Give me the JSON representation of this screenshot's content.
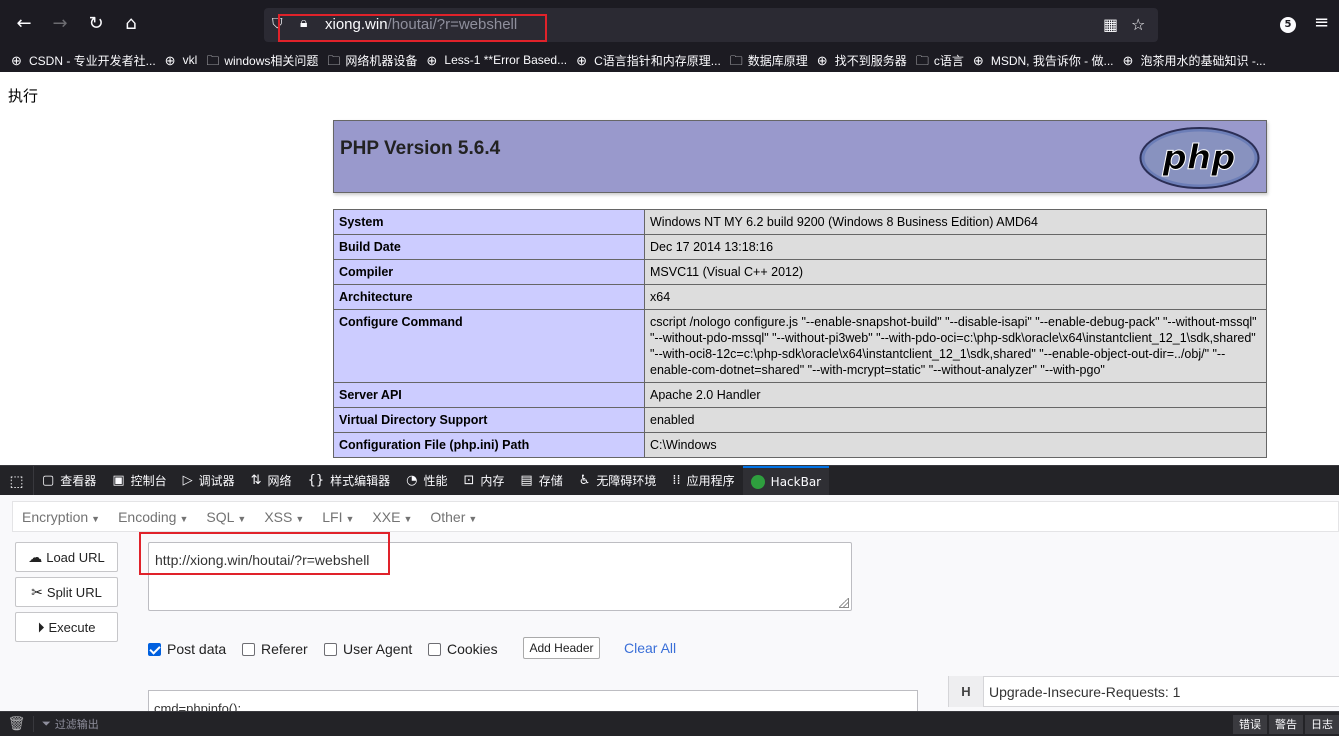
{
  "browser": {
    "url_host": "xiong.win",
    "url_path": "/houtai/?r=webshell",
    "extension_badge": "5"
  },
  "bookmarks": [
    {
      "label": "CSDN - 专业开发者社...",
      "icon": "globe-icon"
    },
    {
      "label": "vkl",
      "icon": "globe-icon"
    },
    {
      "label": "windows相关问题",
      "icon": "folder-icon"
    },
    {
      "label": "网络机器设备",
      "icon": "folder-icon"
    },
    {
      "label": "Less-1 **Error Based...",
      "icon": "globe-icon"
    },
    {
      "label": "C语言指针和内存原理...",
      "icon": "globe-icon"
    },
    {
      "label": "数据库原理",
      "icon": "folder-icon"
    },
    {
      "label": "找不到服务器",
      "icon": "globe-icon"
    },
    {
      "label": "c语言",
      "icon": "folder-icon"
    },
    {
      "label": "MSDN, 我告诉你 - 做...",
      "icon": "globe-icon"
    },
    {
      "label": "泡茶用水的基础知识 -...",
      "icon": "globe-icon"
    }
  ],
  "page": {
    "exec_label": "执行",
    "php_title": "PHP Version 5.6.4",
    "php_logo_text": "php",
    "info_rows": [
      {
        "key": "System",
        "value": "Windows NT MY 6.2 build 9200 (Windows 8 Business Edition) AMD64"
      },
      {
        "key": "Build Date",
        "value": "Dec 17 2014 13:18:16"
      },
      {
        "key": "Compiler",
        "value": "MSVC11 (Visual C++ 2012)"
      },
      {
        "key": "Architecture",
        "value": "x64"
      },
      {
        "key": "Configure Command",
        "value": "cscript /nologo configure.js \"--enable-snapshot-build\" \"--disable-isapi\" \"--enable-debug-pack\" \"--without-mssql\" \"--without-pdo-mssql\" \"--without-pi3web\" \"--with-pdo-oci=c:\\php-sdk\\oracle\\x64\\instantclient_12_1\\sdk,shared\" \"--with-oci8-12c=c:\\php-sdk\\oracle\\x64\\instantclient_12_1\\sdk,shared\" \"--enable-object-out-dir=../obj/\" \"--enable-com-dotnet=shared\" \"--with-mcrypt=static\" \"--without-analyzer\" \"--with-pgo\""
      },
      {
        "key": "Server API",
        "value": "Apache 2.0 Handler"
      },
      {
        "key": "Virtual Directory Support",
        "value": "enabled"
      },
      {
        "key": "Configuration File (php.ini) Path",
        "value": "C:\\Windows"
      }
    ]
  },
  "devtools": {
    "tabs": [
      {
        "label": "查看器",
        "icon": "inspector-icon",
        "glyph": "▢"
      },
      {
        "label": "控制台",
        "icon": "console-icon",
        "glyph": "▣"
      },
      {
        "label": "调试器",
        "icon": "debugger-icon",
        "glyph": "▷"
      },
      {
        "label": "网络",
        "icon": "network-icon",
        "glyph": "⇅"
      },
      {
        "label": "样式编辑器",
        "icon": "style-editor-icon",
        "glyph": "{}"
      },
      {
        "label": "性能",
        "icon": "performance-icon",
        "glyph": "◔"
      },
      {
        "label": "内存",
        "icon": "memory-icon",
        "glyph": "⊡"
      },
      {
        "label": "存储",
        "icon": "storage-icon",
        "glyph": "▤"
      },
      {
        "label": "无障碍环境",
        "icon": "accessibility-icon",
        "glyph": "♿"
      },
      {
        "label": "应用程序",
        "icon": "application-icon",
        "glyph": "⁞⁞"
      },
      {
        "label": "HackBar",
        "icon": "hackbar-icon",
        "glyph": ""
      }
    ]
  },
  "hackbar": {
    "menu": [
      "Encryption",
      "Encoding",
      "SQL",
      "XSS",
      "LFI",
      "XXE",
      "Other"
    ],
    "load_url": "Load URL",
    "split_url": "Split URL",
    "execute": "Execute",
    "url_value": "http://xiong.win/houtai/?r=webshell",
    "options": [
      {
        "label": "Post data",
        "checked": true
      },
      {
        "label": "Referer",
        "checked": false
      },
      {
        "label": "User Agent",
        "checked": false
      },
      {
        "label": "Cookies",
        "checked": false
      }
    ],
    "add_header": "Add Header",
    "clear_all": "Clear All",
    "post_body": "cmd=phpinfo();",
    "header_tag": "H",
    "header_value": "Upgrade-Insecure-Requests: 1"
  },
  "console": {
    "filter_placeholder": "过滤输出",
    "levels": [
      "错误",
      "警告",
      "日志"
    ]
  },
  "colors": {
    "annotation_red": "#e0222a",
    "php_header": "#9999cc",
    "php_key": "#ccccff",
    "php_value": "#dddddd",
    "devtools_active": "#0074e8"
  }
}
